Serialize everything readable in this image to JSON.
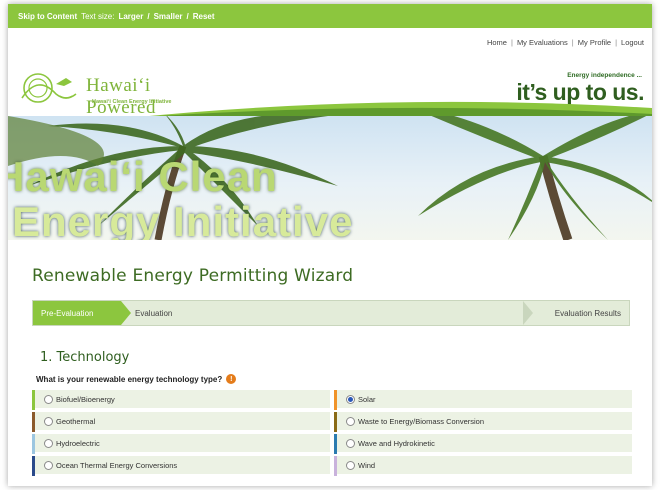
{
  "topbar": {
    "skip_link": "Skip to Content",
    "text_size_label": "Text size:",
    "larger": "Larger",
    "sep1": "/",
    "smaller": "Smaller",
    "sep2": "/",
    "reset": "Reset",
    "color": "#8cc63e"
  },
  "nav": {
    "home": "Home",
    "my_evaluations": "My Evaluations",
    "my_profile": "My Profile",
    "logout": "Logout",
    "separator": "|"
  },
  "header": {
    "logo_title": "Hawaiʻi Powered",
    "logo_subtitle": "Hawaiʻi Clean Energy Initiative",
    "tagline_small": "Energy independence ...",
    "tagline_big": "it’s up to us."
  },
  "banner": {
    "line1": "Hawaiʻi Clean",
    "line2": "Energy Initiative"
  },
  "wizard": {
    "title": "Renewable Energy Permitting Wizard",
    "steps": {
      "pre_evaluation": "Pre-Evaluation",
      "evaluation": "Evaluation",
      "results": "Evaluation Results"
    }
  },
  "section": {
    "title": "1. Technology",
    "question": "What is your renewable energy technology type?",
    "info_icon": "info-icon"
  },
  "options": [
    {
      "label": "Biofuel/Bioenergy",
      "checked": false,
      "bar_color": "#8cc63e"
    },
    {
      "label": "Solar",
      "checked": true,
      "bar_color": "#f0932a"
    },
    {
      "label": "Geothermal",
      "checked": false,
      "bar_color": "#8b5a2b"
    },
    {
      "label": "Waste to Energy/Biomass Conversion",
      "checked": false,
      "bar_color": "#8a6a16"
    },
    {
      "label": "Hydroelectric",
      "checked": false,
      "bar_color": "#9cc6e0"
    },
    {
      "label": "Wave and Hydrokinetic",
      "checked": false,
      "bar_color": "#2b7bb0"
    },
    {
      "label": "Ocean Thermal Energy Conversions",
      "checked": false,
      "bar_color": "#2a4a8a"
    },
    {
      "label": "Wind",
      "checked": false,
      "bar_color": "#c9b2dc"
    }
  ]
}
